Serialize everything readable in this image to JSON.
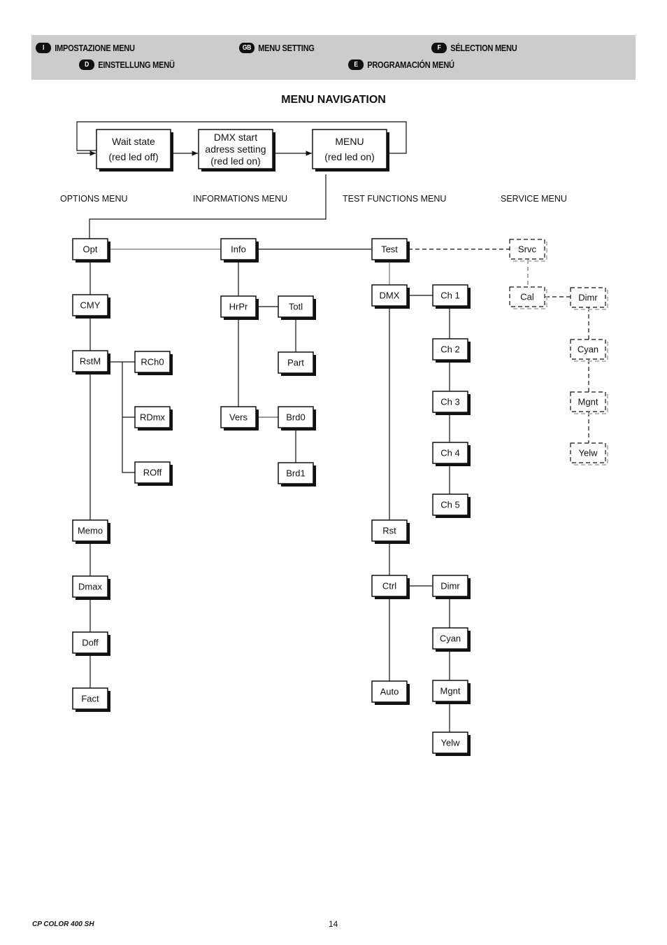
{
  "header": {
    "languages": [
      {
        "badge": "I",
        "label": "IMPOSTAZIONE MENU"
      },
      {
        "badge": "GB",
        "label": "MENU SETTING"
      },
      {
        "badge": "F",
        "label": "SÉLECTION MENU"
      },
      {
        "badge": "D",
        "label": "EINSTELLUNG MENÜ"
      },
      {
        "badge": "E",
        "label": "PROGRAMACIÓN MENÚ"
      }
    ]
  },
  "title": "MENU NAVIGATION",
  "top_flow": {
    "wait": [
      "Wait state",
      "(red led off)"
    ],
    "dmx": [
      "DMX start",
      "adress setting",
      "(red led on)"
    ],
    "menu": [
      "MENU",
      "(red led on)"
    ]
  },
  "sections": {
    "options": "OPTIONS MENU",
    "informations": "INFORMATIONS MENU",
    "test": "TEST FUNCTIONS MENU",
    "service": "SERVICE MENU"
  },
  "nodes": {
    "opt": "Opt",
    "cmy": "CMY",
    "rstm": "RstM",
    "rch0": "RCh0",
    "rdmx": "RDmx",
    "roff": "ROff",
    "memo": "Memo",
    "dmax": "Dmax",
    "doff": "Doff",
    "fact": "Fact",
    "info": "Info",
    "hrpr": "HrPr",
    "totl": "Totl",
    "part": "Part",
    "vers": "Vers",
    "brd0": "Brd0",
    "brd1": "Brd1",
    "test": "Test",
    "dmx": "DMX",
    "ch1": "Ch 1",
    "ch2": "Ch 2",
    "ch3": "Ch 3",
    "ch4": "Ch 4",
    "ch5": "Ch 5",
    "rst": "Rst",
    "ctrl": "Ctrl",
    "dimr": "Dimr",
    "cyan": "Cyan",
    "mgnt": "Mgnt",
    "yelw": "Yelw",
    "auto": "Auto",
    "srvc": "Srvc",
    "cal": "Cal",
    "sdimr": "Dimr",
    "scyan": "Cyan",
    "smgnt": "Mgnt",
    "syelw": "Yelw"
  },
  "footer": {
    "model": "CP COLOR 400 SH",
    "page": "14"
  }
}
